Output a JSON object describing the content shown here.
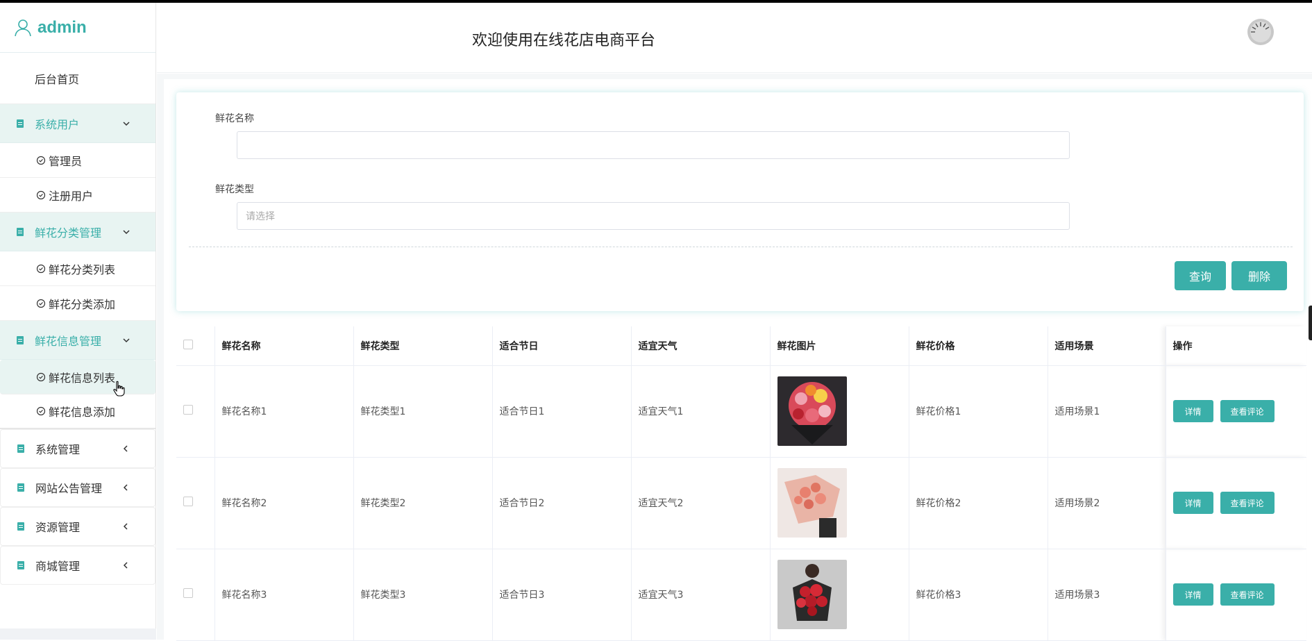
{
  "user": {
    "name": "admin"
  },
  "header": {
    "title": "欢迎使用在线花店电商平台"
  },
  "sidebar": {
    "home": "后台首页",
    "groups": [
      {
        "label": "系统用户",
        "items": [
          "管理员",
          "注册用户"
        ]
      },
      {
        "label": "鲜花分类管理",
        "items": [
          "鲜花分类列表",
          "鲜花分类添加"
        ]
      },
      {
        "label": "鲜花信息管理",
        "items": [
          "鲜花信息列表",
          "鲜花信息添加"
        ]
      },
      {
        "label": "系统管理"
      },
      {
        "label": "网站公告管理"
      },
      {
        "label": "资源管理"
      },
      {
        "label": "商城管理"
      }
    ]
  },
  "search": {
    "name_label": "鲜花名称",
    "name_value": "",
    "type_label": "鲜花类型",
    "type_placeholder": "请选择",
    "query_button": "查询",
    "delete_button": "删除"
  },
  "table": {
    "headers": [
      "鲜花名称",
      "鲜花类型",
      "适合节日",
      "适宜天气",
      "鲜花图片",
      "鲜花价格",
      "适用场景",
      "操作"
    ],
    "rows": [
      {
        "name": "鲜花名称1",
        "type": "鲜花类型1",
        "festival": "适合节日1",
        "weather": "适宜天气1",
        "price": "鲜花价格1",
        "scene": "适用场景1"
      },
      {
        "name": "鲜花名称2",
        "type": "鲜花类型2",
        "festival": "适合节日2",
        "weather": "适宜天气2",
        "price": "鲜花价格2",
        "scene": "适用场景2"
      },
      {
        "name": "鲜花名称3",
        "type": "鲜花类型3",
        "festival": "适合节日3",
        "weather": "适宜天气3",
        "price": "鲜花价格3",
        "scene": "适用场景3"
      }
    ],
    "detail_button": "详情",
    "comment_button": "查看评论"
  },
  "colors": {
    "accent": "#3aafa9",
    "active_bg": "#e8f4f2"
  }
}
